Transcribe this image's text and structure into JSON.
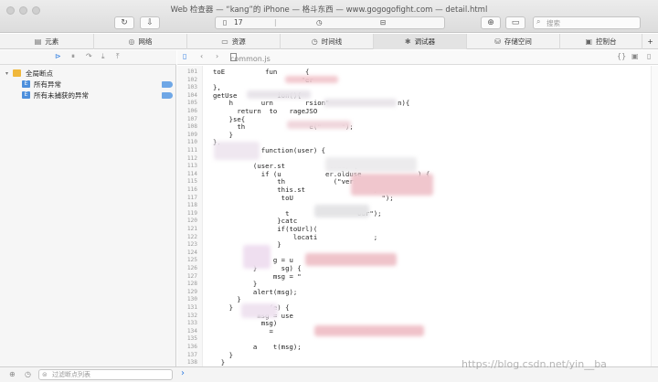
{
  "window": {
    "title": "Web 检查器 — “kang”的 iPhone — 格斗东西 — www.gogogofight.com — detail.html"
  },
  "toolbar": {
    "status_count": "17",
    "search_placeholder": "搜索"
  },
  "tabs": [
    {
      "label": "元素",
      "icon": "elements-icon"
    },
    {
      "label": "网络",
      "icon": "network-icon"
    },
    {
      "label": "资源",
      "icon": "resources-icon"
    },
    {
      "label": "时间线",
      "icon": "timeline-icon"
    },
    {
      "label": "调试器",
      "icon": "debugger-icon",
      "active": true
    },
    {
      "label": "存储空间",
      "icon": "storage-icon"
    },
    {
      "label": "控制台",
      "icon": "console-icon"
    }
  ],
  "sidebar": {
    "group_label": "全局断点",
    "items": [
      {
        "label": "所有异常"
      },
      {
        "label": "所有未捕获的异常"
      }
    ]
  },
  "editor": {
    "file_name": "common.js",
    "line_numbers": [
      "101",
      "102",
      "103",
      "104",
      "105",
      "106",
      "107",
      "108",
      "109",
      "110",
      "111",
      "112",
      "113",
      "114",
      "115",
      "116",
      "117",
      "118",
      "119",
      "120",
      "121",
      "122",
      "123",
      "124",
      "125",
      "126",
      "127",
      "128",
      "129",
      "130",
      "131",
      "132",
      "133",
      "134",
      "135",
      "136",
      "137",
      "138"
    ],
    "lines": [
      "toE          fun       {",
      "                      \"er",
      "},",
      "getUse          ion(){",
      "    h       urn        rsion\"                 n){",
      "      return  to   rageJSO",
      "    }se{",
      "      th                e(\"     \");",
      "    }",
      "},",
      "            function(user) {",
      "",
      "          (user.st           true) {",
      "            if (u           er.olduse              ) {",
      "                th            (\"vers",
      "                this.st                 ;",
      "                 toU                      \");",
      "",
      "                  t                 our\");",
      "                }catc",
      "                if(toUrl)(",
      "                    locati              ;",
      "                }",
      "          }",
      "               g = u",
      "          }      sg) {",
      "               msg = \"",
      "          }",
      "          alert(msg);",
      "      }",
      "    }         (e) {",
      "           msg = use",
      "            msg)",
      "              =                       \"",
      "",
      "          a    t(msg);",
      "    }",
      "  }"
    ]
  },
  "filter": {
    "placeholder": "过滤断点列表"
  },
  "watermark": "https://blog.csdn.net/yin__ba"
}
